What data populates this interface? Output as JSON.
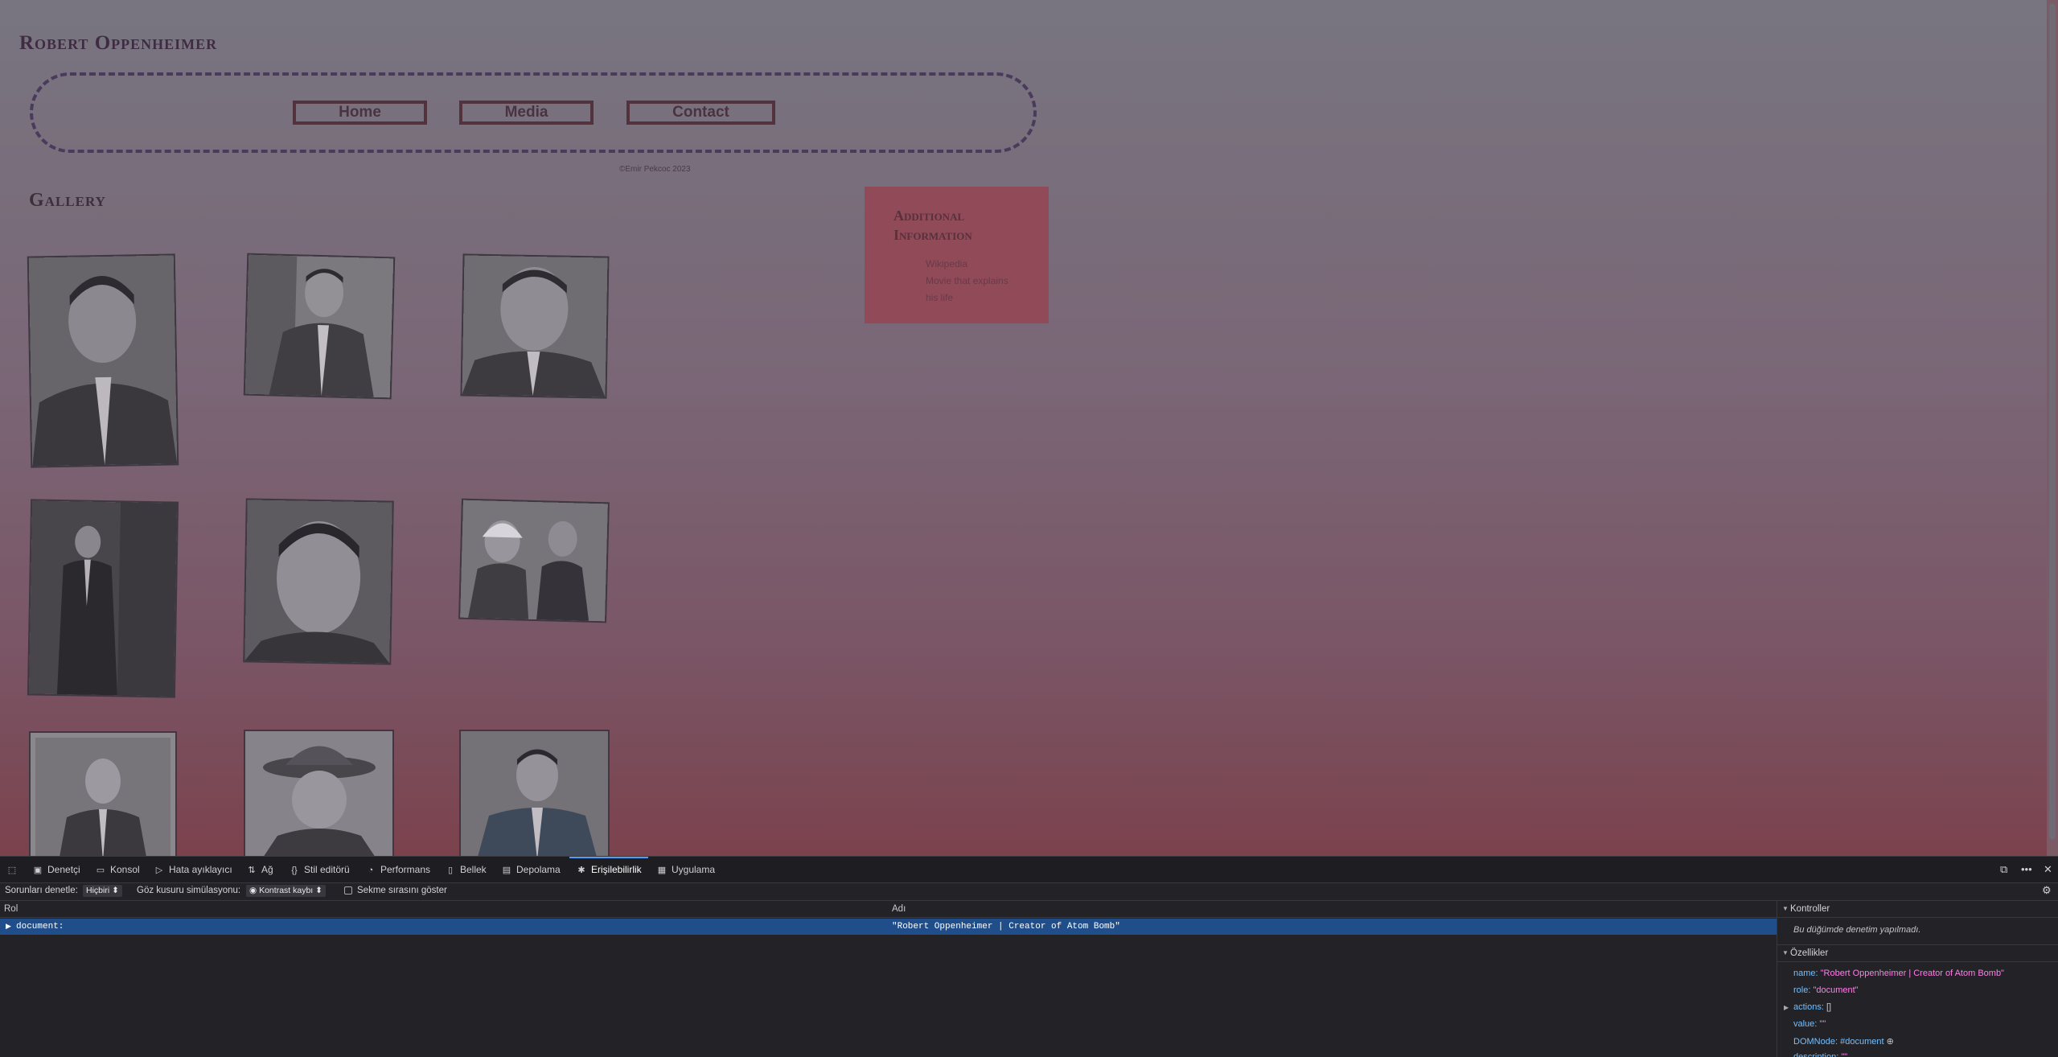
{
  "page": {
    "site_title": "Robert Oppenheimer",
    "nav": [
      {
        "label": "Home"
      },
      {
        "label": "Media"
      },
      {
        "label": "Contact"
      }
    ],
    "copyright": "©Emir Pekcoc 2023",
    "gallery_title": "Gallery",
    "info_box": {
      "title": "Additional Information",
      "links": [
        "Wikipedia",
        "Movie that explains",
        "his life"
      ]
    },
    "gallery_photos": [
      {
        "name": "portrait-1"
      },
      {
        "name": "portrait-2"
      },
      {
        "name": "portrait-3"
      },
      {
        "name": "portrait-4"
      },
      {
        "name": "portrait-5"
      },
      {
        "name": "portrait-6"
      },
      {
        "name": "portrait-7"
      },
      {
        "name": "portrait-8"
      },
      {
        "name": "portrait-9"
      }
    ]
  },
  "devtools": {
    "tabs": [
      {
        "label": "Denetçi",
        "icon": "inspector-icon"
      },
      {
        "label": "Konsol",
        "icon": "console-icon"
      },
      {
        "label": "Hata ayıklayıcı",
        "icon": "debugger-icon"
      },
      {
        "label": "Ağ",
        "icon": "network-icon"
      },
      {
        "label": "Stil editörü",
        "icon": "style-editor-icon"
      },
      {
        "label": "Performans",
        "icon": "performance-icon"
      },
      {
        "label": "Bellek",
        "icon": "memory-icon"
      },
      {
        "label": "Depolama",
        "icon": "storage-icon"
      },
      {
        "label": "Erişilebilirlik",
        "icon": "accessibility-icon",
        "active": true
      },
      {
        "label": "Uygulama",
        "icon": "application-icon"
      }
    ],
    "filter": {
      "check_issues_label": "Sorunları denetle:",
      "check_issues_value": "Hiçbiri",
      "simulate_label": "Göz kusuru simülasyonu:",
      "simulate_value": "Kontrast kaybı",
      "tab_order_label": "Sekme sırasını göster"
    },
    "tree": {
      "col_role": "Rol",
      "col_name": "Adı",
      "row_role": "document:",
      "row_name": "\"Robert Oppenheimer | Creator of Atom Bomb\""
    },
    "sidebar": {
      "checks_title": "Kontroller",
      "checks_note": "Bu düğümde denetim yapılmadı.",
      "props_title": "Özellikler",
      "props": [
        {
          "key": "name:",
          "value": "\"Robert Oppenheimer | Creator of Atom Bomb\""
        },
        {
          "key": "role:",
          "value": "\"document\""
        },
        {
          "key": "actions:",
          "value": "[]"
        },
        {
          "key": "value:",
          "value": "\"\""
        },
        {
          "key": "DOMNode:",
          "value": "#document"
        },
        {
          "key": "description:",
          "value": "\"\""
        }
      ]
    }
  }
}
